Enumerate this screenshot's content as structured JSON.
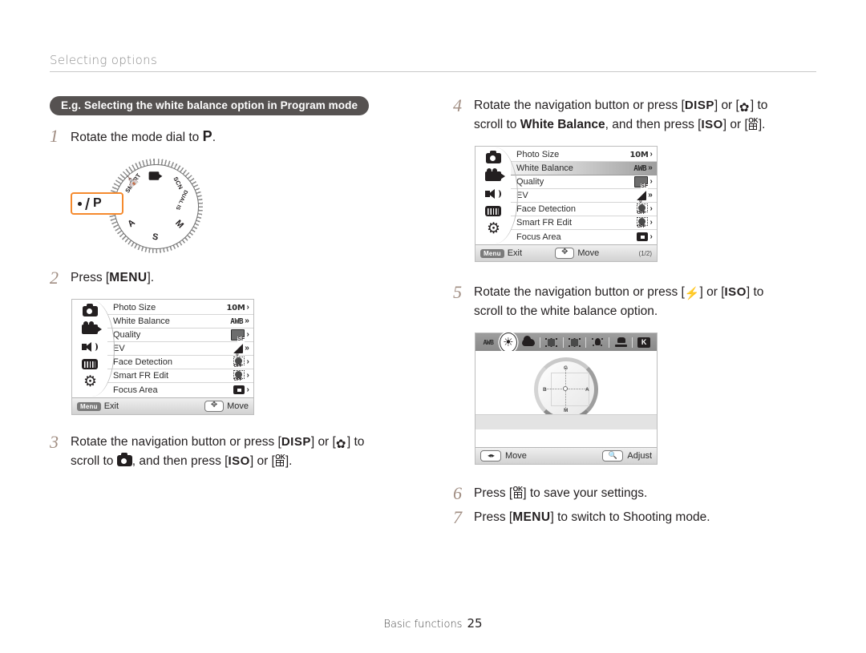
{
  "header": {
    "running_head": "Selecting options"
  },
  "example": {
    "pill_label": "E.g. Selecting the white balance option in Program mode"
  },
  "steps": [
    {
      "num": "1",
      "text_before": "Rotate the mode dial to ",
      "key": "P",
      "text_after": "."
    },
    {
      "num": "2",
      "text_before": "Press [",
      "key": "MENU",
      "text_after": "]."
    },
    {
      "num": "3",
      "line1_a": "Rotate the navigation button or press [",
      "line1_key1": "DISP",
      "line1_b": "] or [",
      "line1_key2": "macro-icon",
      "line1_c": "] to",
      "line2_a": "scroll to ",
      "line2_icon": "camera-icon",
      "line2_b": ", and then press [",
      "line2_key1": "ISO",
      "line2_c": "] or [",
      "line2_key2": "ok-icon",
      "line2_d": "]."
    },
    {
      "num": "4",
      "line1_a": "Rotate the navigation button or press [",
      "line1_key1": "DISP",
      "line1_b": "] or [",
      "line1_key2": "macro-icon",
      "line1_c": "] to",
      "line2_a": "scroll to ",
      "line2_bold": "White Balance",
      "line2_b": ", and then press [",
      "line2_key1": "ISO",
      "line2_c": "] or [",
      "line2_key2": "ok-icon",
      "line2_d": "]."
    },
    {
      "num": "5",
      "line1_a": "Rotate the navigation button or press [",
      "line1_key1": "flash-icon",
      "line1_b": "] or [",
      "line1_key2": "ISO",
      "line1_c": "] to",
      "line2": "scroll to the white balance option."
    },
    {
      "num": "6",
      "text_before": "Press [",
      "key": "ok-icon",
      "text_after": "] to save your settings."
    },
    {
      "num": "7",
      "text_before": "Press [",
      "key": "MENU",
      "text_after": "] to switch to Shooting mode."
    }
  ],
  "mode_dial": {
    "selected": "P",
    "selected_marker_color": "#f58a2e",
    "labels": [
      {
        "name": "movie",
        "text": "movie-icon"
      },
      {
        "name": "scn",
        "text": "SCN"
      },
      {
        "name": "dual-is",
        "text": "DUAL IS"
      },
      {
        "name": "manual",
        "text": "M"
      },
      {
        "name": "shutter",
        "text": "S"
      },
      {
        "name": "aperture",
        "text": "A"
      },
      {
        "name": "smart",
        "text": "SMART"
      },
      {
        "name": "program",
        "text": "P"
      }
    ]
  },
  "menu_screen": {
    "tabs": [
      "shooting-tab-icon",
      "movie-tab-icon",
      "sound-tab-icon",
      "display-tab-icon",
      "settings-tab-icon"
    ],
    "rows": [
      {
        "label": "Photo Size",
        "value": "10M",
        "value_type": "text-10m",
        "arrow": "›"
      },
      {
        "label": "White Balance",
        "value": "AWB",
        "value_type": "text-awb",
        "arrow": "»"
      },
      {
        "label": "Quality",
        "value": "SF",
        "value_type": "quality",
        "arrow": "›"
      },
      {
        "label": "EV",
        "value": "0",
        "value_type": "ev",
        "arrow": "»"
      },
      {
        "label": "Face Detection",
        "value": "OFF",
        "value_type": "face",
        "arrow": "›"
      },
      {
        "label": "Smart FR Edit",
        "value": "OFF",
        "value_type": "face",
        "arrow": "›"
      },
      {
        "label": "Focus Area",
        "value": "",
        "value_type": "focus",
        "arrow": "›"
      }
    ],
    "footer": {
      "menu_button": "Menu",
      "exit_label": "Exit",
      "move_label": "Move",
      "page_indicator": "(1/2)"
    },
    "selected_row_index": 1
  },
  "wb_screen": {
    "options": [
      "AWB",
      "daylight-icon",
      "cloudy-icon",
      "fluorescent-h-icon",
      "fluorescent-l-icon",
      "tungsten-icon",
      "flash-icon",
      "custom-k-icon"
    ],
    "selected_option_index": 1,
    "adjust_letters": {
      "top": "G",
      "left": "B",
      "right": "A",
      "bottom": "M"
    },
    "footer": {
      "move_label": "Move",
      "adjust_label": "Adjust"
    }
  },
  "footer": {
    "section": "Basic functions",
    "page_number": "25"
  }
}
